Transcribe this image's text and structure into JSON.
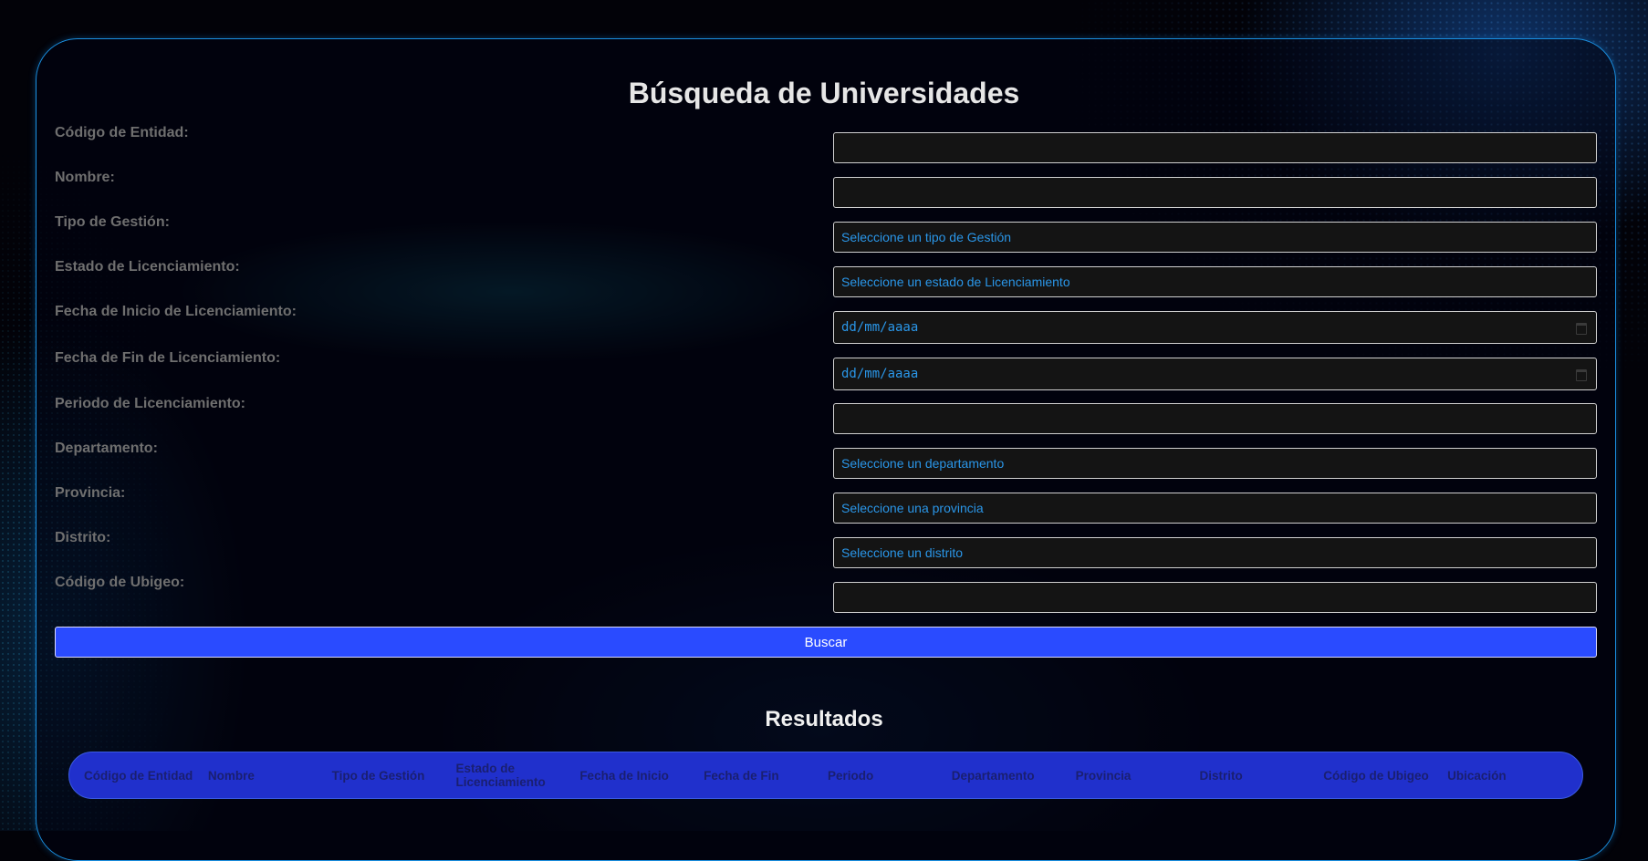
{
  "page": {
    "title": "Búsqueda de Universidades"
  },
  "form": {
    "fields": [
      {
        "label": "Código de Entidad:",
        "type": "text",
        "value": ""
      },
      {
        "label": "Nombre:",
        "type": "text",
        "value": ""
      },
      {
        "label": "Tipo de Gestión:",
        "type": "select",
        "value": "Seleccione un tipo de Gestión"
      },
      {
        "label": "Estado de Licenciamiento:",
        "type": "select",
        "value": "Seleccione un estado de Licenciamiento"
      },
      {
        "label": "Fecha de Inicio de Licenciamiento:",
        "type": "date",
        "value": "dd/mm/aaaa"
      },
      {
        "label": "Fecha de Fin de Licenciamiento:",
        "type": "date",
        "value": "dd/mm/aaaa"
      },
      {
        "label": "Periodo de Licenciamiento:",
        "type": "text",
        "value": ""
      },
      {
        "label": "Departamento:",
        "type": "select",
        "value": "Seleccione un departamento"
      },
      {
        "label": "Provincia:",
        "type": "select",
        "value": "Seleccione una provincia"
      },
      {
        "label": "Distrito:",
        "type": "select",
        "value": "Seleccione un distrito"
      },
      {
        "label": "Código de Ubigeo:",
        "type": "text",
        "value": ""
      }
    ],
    "search_label": "Buscar"
  },
  "results": {
    "title": "Resultados",
    "columns": [
      "Código de Entidad",
      "Nombre",
      "Tipo de Gestión",
      "Estado de Licenciamiento",
      "Fecha de Inicio",
      "Fecha de Fin",
      "Periodo",
      "Departamento",
      "Provincia",
      "Distrito",
      "Código de Ubigeo",
      "Ubicación"
    ]
  },
  "colors": {
    "accent": "#2a4bff",
    "panel_border": "#1a8fe0",
    "field_text": "#2a96e8",
    "label_text": "#6f6f6f"
  },
  "icons": {
    "date_picker": "calendar-icon"
  }
}
